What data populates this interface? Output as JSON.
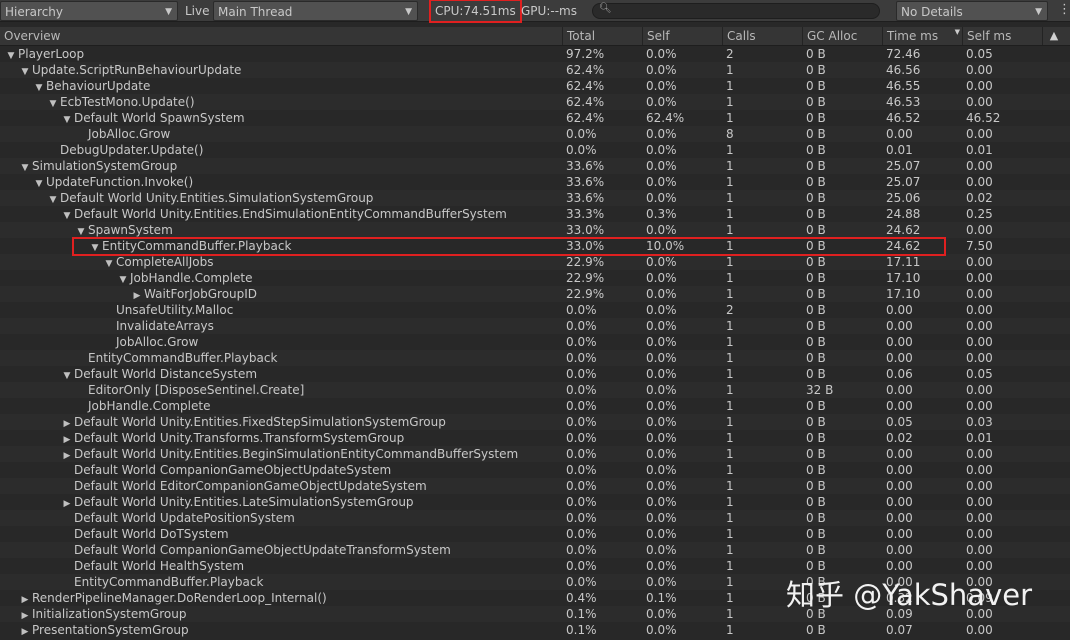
{
  "toolbar": {
    "mode": "Hierarchy",
    "live": "Live",
    "thread": "Main Thread",
    "cpu": "CPU:74.51ms",
    "gpu": "GPU:--ms",
    "search_placeholder": "",
    "details": "No Details"
  },
  "columns": {
    "overview": "Overview",
    "total": "Total",
    "self": "Self",
    "calls": "Calls",
    "gc": "GC Alloc",
    "time": "Time ms",
    "selfms": "Self ms"
  },
  "rows": [
    {
      "indent": 0,
      "expand": "open",
      "name": "PlayerLoop",
      "total": "97.2%",
      "self": "0.0%",
      "calls": "2",
      "gc": "0 B",
      "time": "72.46",
      "selfms": "0.05"
    },
    {
      "indent": 1,
      "expand": "open",
      "name": "Update.ScriptRunBehaviourUpdate",
      "total": "62.4%",
      "self": "0.0%",
      "calls": "1",
      "gc": "0 B",
      "time": "46.56",
      "selfms": "0.00"
    },
    {
      "indent": 2,
      "expand": "open",
      "name": "BehaviourUpdate",
      "total": "62.4%",
      "self": "0.0%",
      "calls": "1",
      "gc": "0 B",
      "time": "46.55",
      "selfms": "0.00"
    },
    {
      "indent": 3,
      "expand": "open",
      "name": "EcbTestMono.Update()",
      "total": "62.4%",
      "self": "0.0%",
      "calls": "1",
      "gc": "0 B",
      "time": "46.53",
      "selfms": "0.00"
    },
    {
      "indent": 4,
      "expand": "open",
      "name": "Default World SpawnSystem",
      "total": "62.4%",
      "self": "62.4%",
      "calls": "1",
      "gc": "0 B",
      "time": "46.52",
      "selfms": "46.52"
    },
    {
      "indent": 5,
      "expand": "none",
      "name": "JobAlloc.Grow",
      "total": "0.0%",
      "self": "0.0%",
      "calls": "8",
      "gc": "0 B",
      "time": "0.00",
      "selfms": "0.00"
    },
    {
      "indent": 3,
      "expand": "none",
      "name": "DebugUpdater.Update()",
      "total": "0.0%",
      "self": "0.0%",
      "calls": "1",
      "gc": "0 B",
      "time": "0.01",
      "selfms": "0.01"
    },
    {
      "indent": 1,
      "expand": "open",
      "name": "SimulationSystemGroup",
      "total": "33.6%",
      "self": "0.0%",
      "calls": "1",
      "gc": "0 B",
      "time": "25.07",
      "selfms": "0.00"
    },
    {
      "indent": 2,
      "expand": "open",
      "name": "UpdateFunction.Invoke()",
      "total": "33.6%",
      "self": "0.0%",
      "calls": "1",
      "gc": "0 B",
      "time": "25.07",
      "selfms": "0.00"
    },
    {
      "indent": 3,
      "expand": "open",
      "name": "Default World Unity.Entities.SimulationSystemGroup",
      "total": "33.6%",
      "self": "0.0%",
      "calls": "1",
      "gc": "0 B",
      "time": "25.06",
      "selfms": "0.02"
    },
    {
      "indent": 4,
      "expand": "open",
      "name": "Default World Unity.Entities.EndSimulationEntityCommandBufferSystem",
      "total": "33.3%",
      "self": "0.3%",
      "calls": "1",
      "gc": "0 B",
      "time": "24.88",
      "selfms": "0.25"
    },
    {
      "indent": 5,
      "expand": "open",
      "name": "SpawnSystem",
      "total": "33.0%",
      "self": "0.0%",
      "calls": "1",
      "gc": "0 B",
      "time": "24.62",
      "selfms": "0.00"
    },
    {
      "indent": 6,
      "expand": "open",
      "name": "EntityCommandBuffer.Playback",
      "total": "33.0%",
      "self": "10.0%",
      "calls": "1",
      "gc": "0 B",
      "time": "24.62",
      "selfms": "7.50"
    },
    {
      "indent": 7,
      "expand": "open",
      "name": "CompleteAllJobs",
      "total": "22.9%",
      "self": "0.0%",
      "calls": "1",
      "gc": "0 B",
      "time": "17.11",
      "selfms": "0.00"
    },
    {
      "indent": 8,
      "expand": "open",
      "name": "JobHandle.Complete",
      "total": "22.9%",
      "self": "0.0%",
      "calls": "1",
      "gc": "0 B",
      "time": "17.10",
      "selfms": "0.00"
    },
    {
      "indent": 9,
      "expand": "closed",
      "name": "WaitForJobGroupID",
      "total": "22.9%",
      "self": "0.0%",
      "calls": "1",
      "gc": "0 B",
      "time": "17.10",
      "selfms": "0.00"
    },
    {
      "indent": 7,
      "expand": "none",
      "name": "UnsafeUtility.Malloc",
      "total": "0.0%",
      "self": "0.0%",
      "calls": "2",
      "gc": "0 B",
      "time": "0.00",
      "selfms": "0.00"
    },
    {
      "indent": 7,
      "expand": "none",
      "name": "InvalidateArrays",
      "total": "0.0%",
      "self": "0.0%",
      "calls": "1",
      "gc": "0 B",
      "time": "0.00",
      "selfms": "0.00"
    },
    {
      "indent": 7,
      "expand": "none",
      "name": "JobAlloc.Grow",
      "total": "0.0%",
      "self": "0.0%",
      "calls": "1",
      "gc": "0 B",
      "time": "0.00",
      "selfms": "0.00"
    },
    {
      "indent": 5,
      "expand": "none",
      "name": "EntityCommandBuffer.Playback",
      "total": "0.0%",
      "self": "0.0%",
      "calls": "1",
      "gc": "0 B",
      "time": "0.00",
      "selfms": "0.00"
    },
    {
      "indent": 4,
      "expand": "open",
      "name": "Default World DistanceSystem",
      "total": "0.0%",
      "self": "0.0%",
      "calls": "1",
      "gc": "0 B",
      "time": "0.06",
      "selfms": "0.05"
    },
    {
      "indent": 5,
      "expand": "none",
      "name": "EditorOnly [DisposeSentinel.Create]",
      "total": "0.0%",
      "self": "0.0%",
      "calls": "1",
      "gc": "32 B",
      "time": "0.00",
      "selfms": "0.00"
    },
    {
      "indent": 5,
      "expand": "none",
      "name": "JobHandle.Complete",
      "total": "0.0%",
      "self": "0.0%",
      "calls": "1",
      "gc": "0 B",
      "time": "0.00",
      "selfms": "0.00"
    },
    {
      "indent": 4,
      "expand": "closed",
      "name": "Default World Unity.Entities.FixedStepSimulationSystemGroup",
      "total": "0.0%",
      "self": "0.0%",
      "calls": "1",
      "gc": "0 B",
      "time": "0.05",
      "selfms": "0.03"
    },
    {
      "indent": 4,
      "expand": "closed",
      "name": "Default World Unity.Transforms.TransformSystemGroup",
      "total": "0.0%",
      "self": "0.0%",
      "calls": "1",
      "gc": "0 B",
      "time": "0.02",
      "selfms": "0.01"
    },
    {
      "indent": 4,
      "expand": "closed",
      "name": "Default World Unity.Entities.BeginSimulationEntityCommandBufferSystem",
      "total": "0.0%",
      "self": "0.0%",
      "calls": "1",
      "gc": "0 B",
      "time": "0.00",
      "selfms": "0.00"
    },
    {
      "indent": 4,
      "expand": "none",
      "name": "Default World CompanionGameObjectUpdateSystem",
      "total": "0.0%",
      "self": "0.0%",
      "calls": "1",
      "gc": "0 B",
      "time": "0.00",
      "selfms": "0.00"
    },
    {
      "indent": 4,
      "expand": "none",
      "name": "Default World EditorCompanionGameObjectUpdateSystem",
      "total": "0.0%",
      "self": "0.0%",
      "calls": "1",
      "gc": "0 B",
      "time": "0.00",
      "selfms": "0.00"
    },
    {
      "indent": 4,
      "expand": "closed",
      "name": "Default World Unity.Entities.LateSimulationSystemGroup",
      "total": "0.0%",
      "self": "0.0%",
      "calls": "1",
      "gc": "0 B",
      "time": "0.00",
      "selfms": "0.00"
    },
    {
      "indent": 4,
      "expand": "none",
      "name": "Default World UpdatePositionSystem",
      "total": "0.0%",
      "self": "0.0%",
      "calls": "1",
      "gc": "0 B",
      "time": "0.00",
      "selfms": "0.00"
    },
    {
      "indent": 4,
      "expand": "none",
      "name": "Default World DoTSystem",
      "total": "0.0%",
      "self": "0.0%",
      "calls": "1",
      "gc": "0 B",
      "time": "0.00",
      "selfms": "0.00"
    },
    {
      "indent": 4,
      "expand": "none",
      "name": "Default World CompanionGameObjectUpdateTransformSystem",
      "total": "0.0%",
      "self": "0.0%",
      "calls": "1",
      "gc": "0 B",
      "time": "0.00",
      "selfms": "0.00"
    },
    {
      "indent": 4,
      "expand": "none",
      "name": "Default World HealthSystem",
      "total": "0.0%",
      "self": "0.0%",
      "calls": "1",
      "gc": "0 B",
      "time": "0.00",
      "selfms": "0.00"
    },
    {
      "indent": 4,
      "expand": "none",
      "name": "EntityCommandBuffer.Playback",
      "total": "0.0%",
      "self": "0.0%",
      "calls": "1",
      "gc": "0 B",
      "time": "0.00",
      "selfms": "0.00"
    },
    {
      "indent": 1,
      "expand": "closed",
      "name": "RenderPipelineManager.DoRenderLoop_Internal()",
      "total": "0.4%",
      "self": "0.1%",
      "calls": "1",
      "gc": "0 B",
      "time": "0.32",
      "selfms": "0.09"
    },
    {
      "indent": 1,
      "expand": "closed",
      "name": "InitializationSystemGroup",
      "total": "0.1%",
      "self": "0.0%",
      "calls": "1",
      "gc": "0 B",
      "time": "0.09",
      "selfms": "0.00"
    },
    {
      "indent": 1,
      "expand": "closed",
      "name": "PresentationSystemGroup",
      "total": "0.1%",
      "self": "0.0%",
      "calls": "1",
      "gc": "0 B",
      "time": "0.07",
      "selfms": "0.00"
    }
  ],
  "watermark": "知乎 @YakShaver"
}
